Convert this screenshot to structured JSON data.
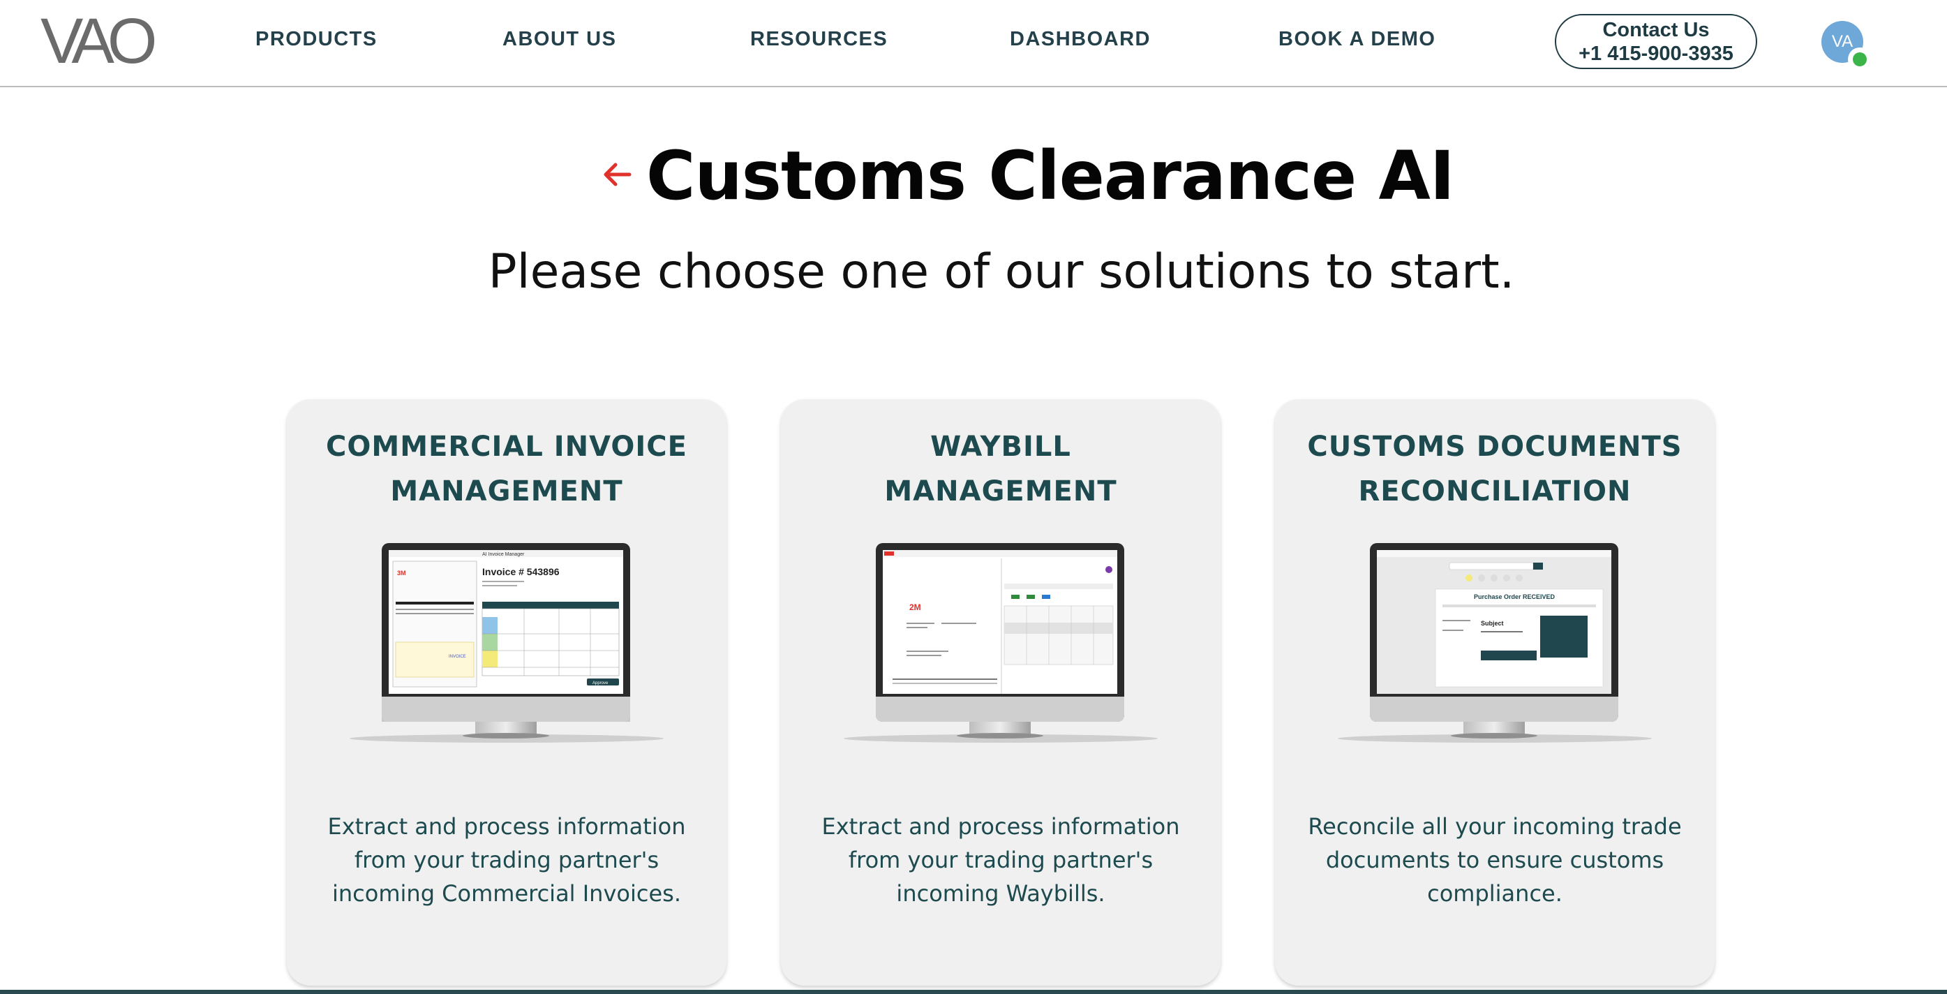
{
  "header": {
    "logo_text": "VAO",
    "nav": [
      {
        "label": "PRODUCTS"
      },
      {
        "label": "ABOUT US"
      },
      {
        "label": "RESOURCES"
      },
      {
        "label": "DASHBOARD"
      },
      {
        "label": "BOOK A DEMO"
      }
    ],
    "contact": {
      "line1": "Contact Us",
      "line2": "+1 415-900-3935"
    },
    "avatar_initials": "VA"
  },
  "main": {
    "title": "Customs Clearance AI",
    "subtitle": "Please choose one of our solutions to start."
  },
  "cards": [
    {
      "title_line1": "COMMERCIAL INVOICE",
      "title_line2": "MANAGEMENT",
      "description": "Extract and process information from your trading partner's incoming Commercial Invoices.",
      "screen": {
        "heading": "AI Invoice Manager",
        "doc_title": "Invoice # 543896",
        "brand": "3M",
        "badge": "INVOICE",
        "action": "Approve"
      }
    },
    {
      "title_line1": "WAYBILL",
      "title_line2": "MANAGEMENT",
      "description": "Extract and process information from your trading partner's incoming Waybills.",
      "screen": {
        "brand": "2M"
      }
    },
    {
      "title_line1": "CUSTOMS DOCUMENTS",
      "title_line2": "RECONCILIATION",
      "description": "Reconcile all your incoming trade documents to ensure customs compliance.",
      "screen": {
        "heading": "Purchase Order RECEIVED",
        "field": "Subject"
      }
    }
  ],
  "colors": {
    "accent": "#e0312b",
    "card_text": "#1d4a4e",
    "nav_text": "#24404a",
    "online": "#3bb54a"
  }
}
